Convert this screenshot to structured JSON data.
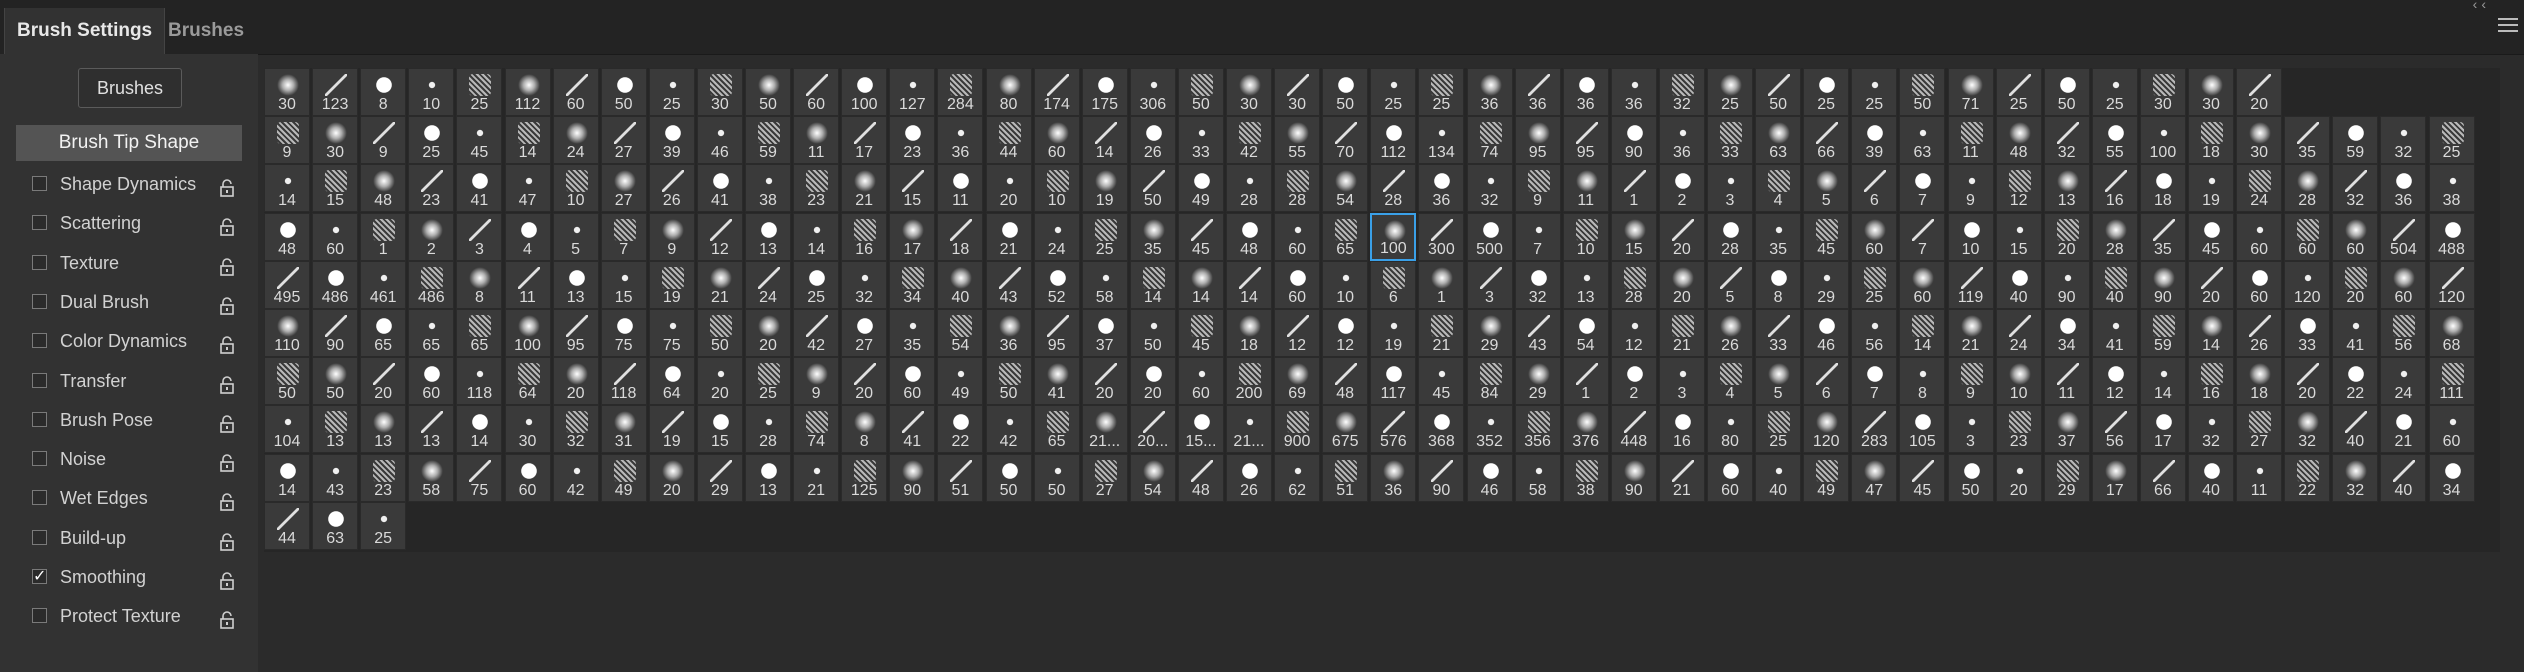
{
  "tabs": [
    {
      "label": "Brush Settings"
    },
    {
      "label": "Brushes"
    }
  ],
  "sidebar": {
    "brushes_button": "Brushes",
    "tip_shape": "Brush Tip Shape",
    "options": [
      {
        "label": "Shape Dynamics",
        "checked": false
      },
      {
        "label": "Scattering",
        "checked": false
      },
      {
        "label": "Texture",
        "checked": false
      },
      {
        "label": "Dual Brush",
        "checked": false
      },
      {
        "label": "Color Dynamics",
        "checked": false
      },
      {
        "label": "Transfer",
        "checked": false
      },
      {
        "label": "Brush Pose",
        "checked": false
      },
      {
        "label": "Noise",
        "checked": false
      },
      {
        "label": "Wet Edges",
        "checked": false
      },
      {
        "label": "Build-up",
        "checked": false
      },
      {
        "label": "Smoothing",
        "checked": true
      },
      {
        "label": "Protect Texture",
        "checked": false
      }
    ]
  },
  "selected_brush": {
    "row": 3,
    "col": 23
  },
  "brush_rows": [
    [
      "30",
      "123",
      "8",
      "10",
      "25",
      "112",
      "60",
      "50",
      "25",
      "30",
      "50",
      "60",
      "100",
      "127",
      "284",
      "80",
      "174",
      "175",
      "306",
      "50",
      "30",
      "30",
      "50",
      "25",
      "25",
      "36",
      "36",
      "36",
      "36",
      "32",
      "25",
      "50",
      "25",
      "25",
      "50",
      "71",
      "25",
      "50",
      "25",
      "30",
      "30",
      "20"
    ],
    [
      "9",
      "30",
      "9",
      "25",
      "45",
      "14",
      "24",
      "27",
      "39",
      "46",
      "59",
      "11",
      "17",
      "23",
      "36",
      "44",
      "60",
      "14",
      "26",
      "33",
      "42",
      "55",
      "70",
      "112",
      "134",
      "74",
      "95",
      "95",
      "90",
      "36",
      "33",
      "63",
      "66",
      "39",
      "63",
      "11",
      "48",
      "32",
      "55",
      "100",
      "18",
      "30",
      "35",
      "59",
      "32",
      "25"
    ],
    [
      "14",
      "15",
      "48",
      "23",
      "41",
      "47",
      "10",
      "27",
      "26",
      "41",
      "38",
      "23",
      "21",
      "15",
      "11",
      "20",
      "10",
      "19",
      "50",
      "49",
      "28",
      "28",
      "54",
      "28",
      "36",
      "32",
      "9",
      "11",
      "1",
      "2",
      "3",
      "4",
      "5",
      "6",
      "7",
      "9",
      "12",
      "13",
      "16",
      "18",
      "19",
      "24",
      "28",
      "32",
      "36",
      "38"
    ],
    [
      "48",
      "60",
      "1",
      "2",
      "3",
      "4",
      "5",
      "7",
      "9",
      "12",
      "13",
      "14",
      "16",
      "17",
      "18",
      "21",
      "24",
      "25",
      "35",
      "45",
      "48",
      "60",
      "65",
      "100",
      "300",
      "500",
      "7",
      "10",
      "15",
      "20",
      "28",
      "35",
      "45",
      "60",
      "7",
      "10",
      "15",
      "20",
      "28",
      "35",
      "45",
      "60",
      "60",
      "60",
      "504",
      "488"
    ],
    [
      "495",
      "486",
      "461",
      "486",
      "8",
      "11",
      "13",
      "15",
      "19",
      "21",
      "24",
      "25",
      "32",
      "34",
      "40",
      "43",
      "52",
      "58",
      "14",
      "14",
      "14",
      "60",
      "10",
      "6",
      "1",
      "3",
      "32",
      "13",
      "28",
      "20",
      "5",
      "8",
      "29",
      "25",
      "60",
      "119",
      "40",
      "90",
      "40",
      "90",
      "20",
      "60",
      "120",
      "20",
      "60",
      "120"
    ],
    [
      "110",
      "90",
      "65",
      "65",
      "65",
      "100",
      "95",
      "75",
      "75",
      "50",
      "20",
      "42",
      "27",
      "35",
      "54",
      "36",
      "95",
      "37",
      "50",
      "45",
      "18",
      "12",
      "12",
      "19",
      "21",
      "29",
      "43",
      "54",
      "12",
      "21",
      "26",
      "33",
      "46",
      "56",
      "14",
      "21",
      "24",
      "34",
      "41",
      "59",
      "14",
      "26",
      "33",
      "41",
      "56",
      "68"
    ],
    [
      "50",
      "50",
      "20",
      "60",
      "118",
      "64",
      "20",
      "118",
      "64",
      "20",
      "25",
      "9",
      "20",
      "60",
      "49",
      "50",
      "41",
      "20",
      "20",
      "60",
      "200",
      "69",
      "48",
      "117",
      "45",
      "84",
      "29",
      "1",
      "2",
      "3",
      "4",
      "5",
      "6",
      "7",
      "8",
      "9",
      "10",
      "11",
      "12",
      "14",
      "16",
      "18",
      "20",
      "22",
      "24",
      "111"
    ],
    [
      "104",
      "13",
      "13",
      "13",
      "14",
      "30",
      "32",
      "31",
      "19",
      "15",
      "28",
      "74",
      "8",
      "41",
      "22",
      "42",
      "65",
      "21...",
      "20...",
      "15...",
      "21...",
      "900",
      "675",
      "576",
      "368",
      "352",
      "356",
      "376",
      "448",
      "16",
      "80",
      "25",
      "120",
      "283",
      "105",
      "3",
      "23",
      "37",
      "56",
      "17",
      "32",
      "27",
      "32",
      "40",
      "21",
      "60"
    ],
    [
      "14",
      "43",
      "23",
      "58",
      "75",
      "60",
      "42",
      "49",
      "20",
      "29",
      "13",
      "21",
      "125",
      "90",
      "51",
      "50",
      "50",
      "27",
      "54",
      "48",
      "26",
      "62",
      "51",
      "36",
      "90",
      "46",
      "58",
      "38",
      "90",
      "21",
      "60",
      "40",
      "49",
      "47",
      "45",
      "50",
      "20",
      "29",
      "17",
      "66",
      "40",
      "11",
      "22",
      "32",
      "40",
      "34"
    ],
    [
      "44",
      "63",
      "25"
    ]
  ]
}
